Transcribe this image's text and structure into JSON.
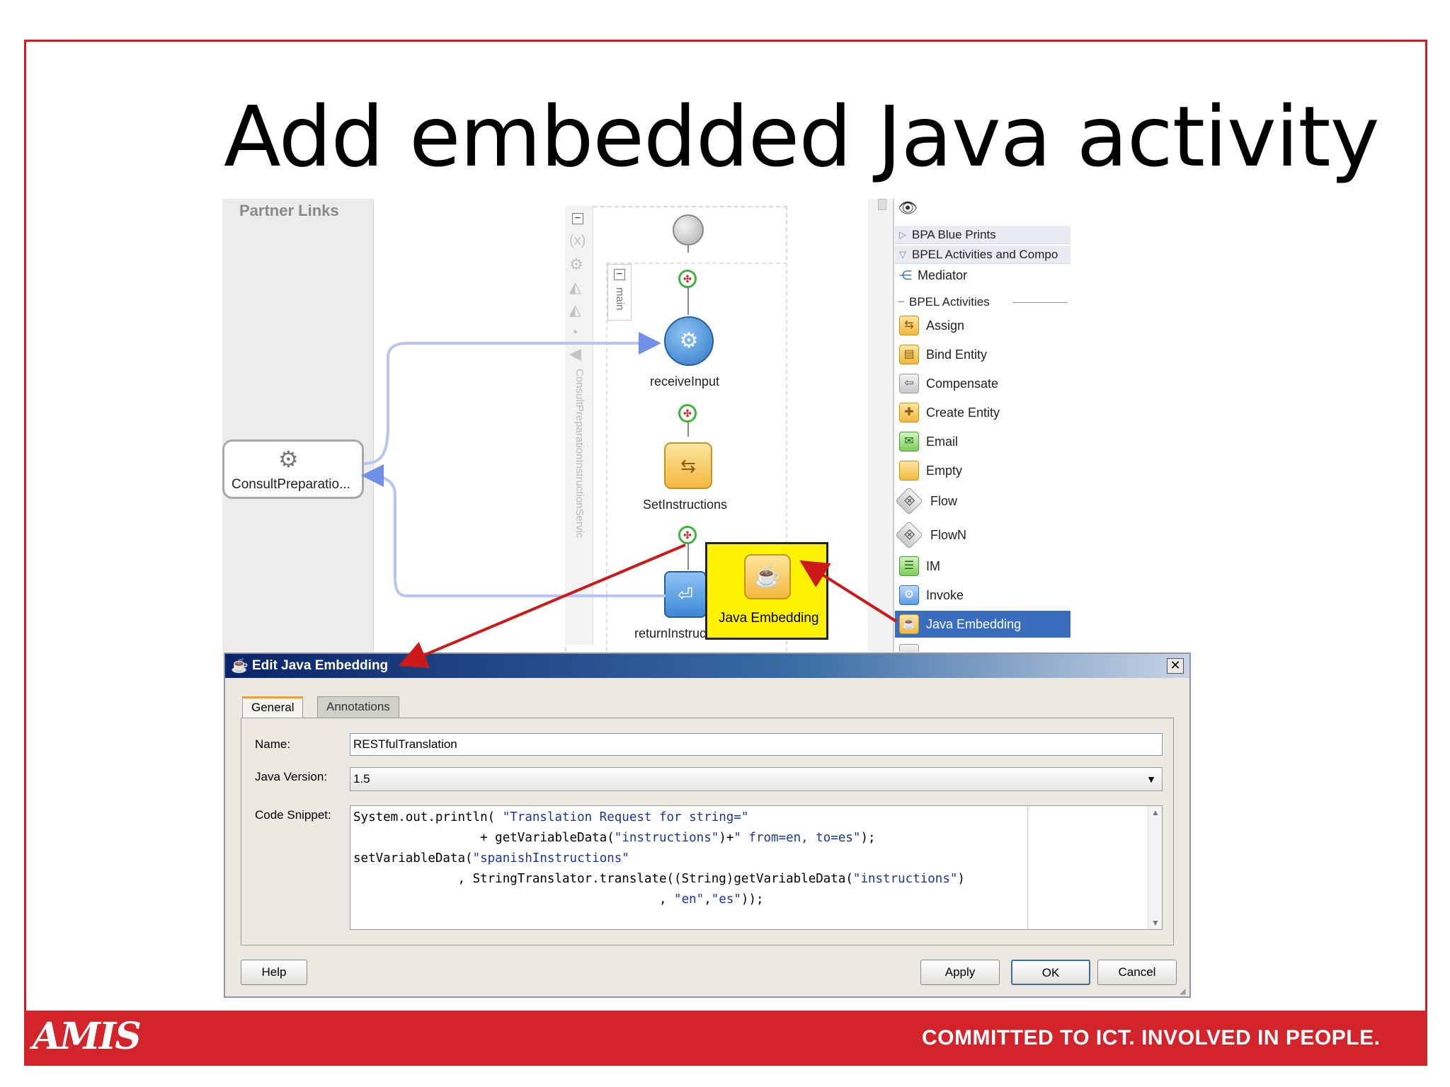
{
  "slide": {
    "title": "Add embedded Java activity",
    "footer_logo": "AMIS",
    "footer_slogan": "COMMITTED TO ICT.  INVOLVED IN PEOPLE.",
    "accent_color": "#d3242c"
  },
  "designer": {
    "partner_links_header": "Partner Links",
    "partner_link_name": "ConsultPreparatio...",
    "scope_label": "ConsultPreparationInstructionServic",
    "main_label": "main",
    "activities": {
      "receive": "receiveInput",
      "assign": "SetInstructions",
      "reply": "returnInstructions"
    },
    "java_tile_label": "Java Embedding"
  },
  "palette": {
    "groups": [
      "BPA Blue Prints",
      "BPEL Activities and Compo"
    ],
    "mediator": "Mediator",
    "section": "BPEL Activities",
    "items": [
      {
        "label": "Assign",
        "icon": "assign-icon"
      },
      {
        "label": "Bind Entity",
        "icon": "bind-entity-icon"
      },
      {
        "label": "Compensate",
        "icon": "compensate-icon"
      },
      {
        "label": "Create Entity",
        "icon": "create-entity-icon"
      },
      {
        "label": "Email",
        "icon": "email-icon"
      },
      {
        "label": "Empty",
        "icon": "empty-icon"
      },
      {
        "label": "Flow",
        "icon": "flow-icon"
      },
      {
        "label": "FlowN",
        "icon": "flown-icon"
      },
      {
        "label": "IM",
        "icon": "im-icon"
      },
      {
        "label": "Invoke",
        "icon": "invoke-icon"
      },
      {
        "label": "Java Embedding",
        "icon": "java-embedding-icon",
        "selected": true
      }
    ]
  },
  "dialog": {
    "title": "Edit Java Embedding",
    "tabs": [
      "General",
      "Annotations"
    ],
    "labels": {
      "name": "Name:",
      "java_version": "Java Version:",
      "code_snippet": "Code Snippet:"
    },
    "name_value": "RESTfulTranslation",
    "java_version_value": "1.5",
    "code": {
      "l1a": "System.out.println( ",
      "l1b": "\"Translation Request for string=\"",
      "l2a": "                 + getVariableData(",
      "l2b": "\"instructions\"",
      "l2c": ")+",
      "l2d": "\" from=en, to=es\"",
      "l2e": ");",
      "l3a": "setVariableData(",
      "l3b": "\"spanishInstructions\"",
      "l4a": "              , StringTranslator.translate((String)getVariableData(",
      "l4b": "\"instructions\"",
      "l4c": ")",
      "l5a": "                                         , ",
      "l5b": "\"en\"",
      "l5c": ",",
      "l5d": "\"es\"",
      "l5e": "));"
    },
    "buttons": {
      "help": "Help",
      "apply": "Apply",
      "ok": "OK",
      "cancel": "Cancel"
    }
  }
}
